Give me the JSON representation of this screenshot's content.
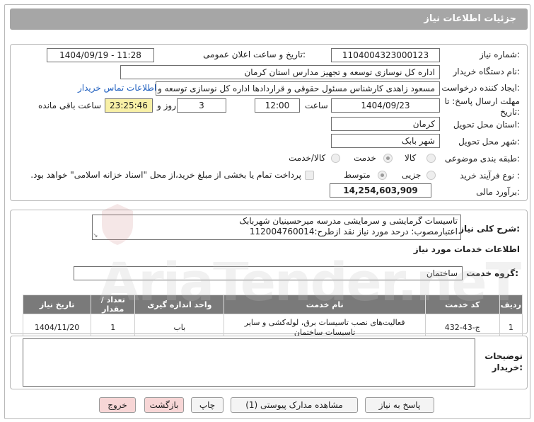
{
  "header": {
    "title": "جزئیات اطلاعات نیاز"
  },
  "info": {
    "need_number_label": "شماره نیاز:",
    "need_number": "1104004323000123",
    "announce_label": "تاریخ و ساعت اعلان عمومی:",
    "announce_value": "1404/09/19 - 11:28",
    "buyer_org_label": "نام دستگاه خریدار:",
    "buyer_org": "اداره کل نوسازی  توسعه و تجهیز مدارس استان کرمان",
    "creator_label": "ایجاد کننده درخواست:",
    "creator": "مسعود زاهدی کارشناس مسئول حقوقی و قراردادها اداره کل نوسازی  توسعه و",
    "contact_link": "اطلاعات تماس خریدار",
    "deadline_label_line1": "مهلت ارسال پاسخ: تا",
    "deadline_label_line2": "تاریخ:",
    "deadline_date": "1404/09/23",
    "time_label": "ساعت",
    "deadline_time": "12:00",
    "days_value": "3",
    "days_label": "روز و",
    "remaining_time": "23:25:46",
    "remaining_label": "ساعت باقی مانده",
    "province_label": "استان محل تحویل:",
    "province": "کرمان",
    "city_label": "شهر محل تحویل:",
    "city": "شهر بابک",
    "category_label": "طبقه بندی موضوعی:",
    "category_options": [
      "کالا",
      "خدمت",
      "کالا/خدمت"
    ],
    "category_selected": "خدمت",
    "process_label": "نوع فرآیند خرید :",
    "process_options": [
      "جزیی",
      "متوسط"
    ],
    "process_selected": "متوسط",
    "payment_note": "پرداخت تمام یا بخشی از مبلغ خرید،از محل \"اسناد خزانه اسلامی\" خواهد بود.",
    "estimate_label": "برآورد مالی:",
    "estimate": "14,254,603,909"
  },
  "description": {
    "label": "شرح کلی نیاز:",
    "line1": "تاسیسات گرمایشی و سرمایشی مدرسه میرحسینیان شهربابک",
    "line2": "اعتبارمصوب: درحد مورد نیاز نقد  ازطرح:112004760014"
  },
  "services": {
    "section_title": "اطلاعات خدمات مورد نیاز",
    "group_label": "گروه خدمت:",
    "group_value": "ساختمان",
    "columns": [
      "ردیف",
      "کد خدمت",
      "نام خدمت",
      "واحد اندازه گیری",
      "تعداد / مقدار",
      "تاریخ نیاز"
    ],
    "rows": [
      {
        "row": "1",
        "code": "ج-43-432",
        "name_line1": "فعالیت‌های نصب تاسیسات برق، لوله‌کشی و سایر",
        "name_line2": "تاسیسات ساختمان",
        "unit": "باب",
        "qty": "1",
        "date": "1404/11/20"
      }
    ]
  },
  "buyer_notes": {
    "label_line1": "توضیحات",
    "label_line2": "خریدار:",
    "value": ""
  },
  "buttons": {
    "reply": "پاسخ به نیاز",
    "attachments": "مشاهده مدارک پیوستی (1)",
    "print": "چاپ",
    "back": "بازگشت",
    "exit": "خروج"
  },
  "watermark": "AriaTender.neT"
}
